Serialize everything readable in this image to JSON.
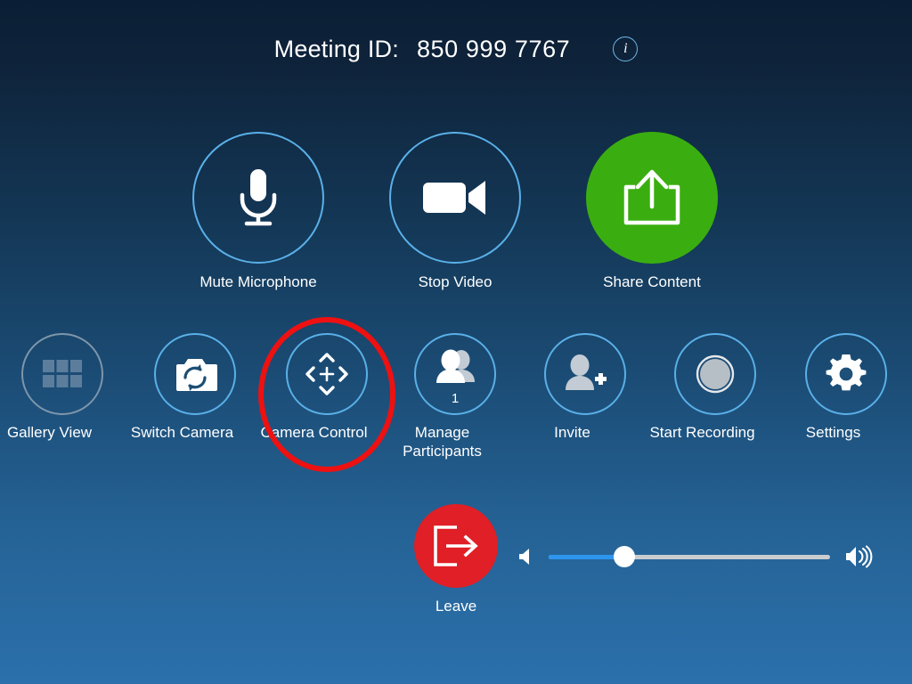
{
  "header": {
    "meeting_id_label": "Meeting ID:",
    "meeting_id_value": "850 999 7767",
    "info_icon_glyph": "i",
    "info_icon_name": "info-icon"
  },
  "primary_controls": [
    {
      "id": "mute-microphone",
      "label": "Mute Microphone",
      "icon": "microphone-icon",
      "style": "outline",
      "accent": "#5ab0e8"
    },
    {
      "id": "stop-video",
      "label": "Stop Video",
      "icon": "video-camera-icon",
      "style": "outline",
      "accent": "#5ab0e8"
    },
    {
      "id": "share-content",
      "label": "Share Content",
      "icon": "share-upload-icon",
      "style": "filled",
      "accent": "#3aae10"
    }
  ],
  "secondary_controls": [
    {
      "id": "gallery-view",
      "label": "Gallery View",
      "icon": "grid-view-icon",
      "state": "disabled",
      "accent": "#7e96ab"
    },
    {
      "id": "switch-camera",
      "label": "Switch Camera",
      "icon": "switch-camera-icon",
      "state": "enabled",
      "accent": "#5ab0e8"
    },
    {
      "id": "camera-control",
      "label": "Camera Control",
      "icon": "camera-pan-tilt-icon",
      "state": "enabled",
      "accent": "#5ab0e8",
      "highlighted": true
    },
    {
      "id": "manage-participants",
      "label": "Manage\nParticipants",
      "icon": "participants-icon",
      "state": "enabled",
      "accent": "#5ab0e8",
      "badge": "1"
    },
    {
      "id": "invite",
      "label": "Invite",
      "icon": "add-person-icon",
      "state": "enabled",
      "accent": "#5ab0e8"
    },
    {
      "id": "start-recording",
      "label": "Start Recording",
      "icon": "record-button-icon",
      "state": "enabled",
      "accent": "#5ab0e8"
    },
    {
      "id": "settings",
      "label": "Settings",
      "icon": "gear-icon",
      "state": "enabled",
      "accent": "#5ab0e8"
    }
  ],
  "leave": {
    "label": "Leave",
    "icon": "exit-door-arrow-icon",
    "accent": "#e01f26"
  },
  "volume": {
    "low_icon": "speaker-low-icon",
    "high_icon": "speaker-high-icon",
    "value_percent": 27,
    "fill_color": "#2e95ef",
    "track_color": "#c9cdd0"
  },
  "annotation": {
    "shape": "ellipse",
    "color": "#ee1111",
    "target": "camera-control"
  },
  "background": {
    "top_color": "#0a1f35",
    "bottom_color": "#2b70ac"
  }
}
